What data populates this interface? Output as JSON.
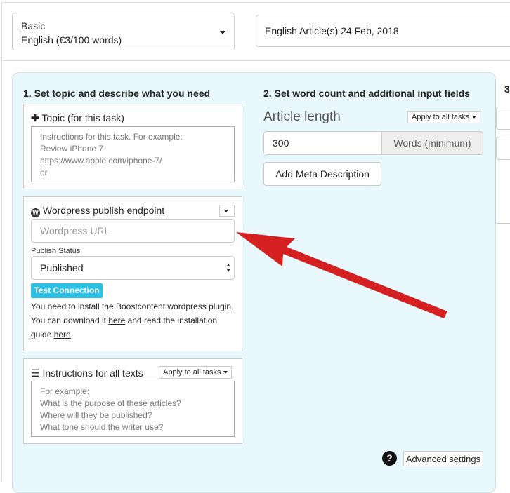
{
  "header": {
    "plan_line1": "Basic",
    "plan_line2": "English (€3/100 words)",
    "project_title": "English Article(s) 24 Feb, 2018"
  },
  "step1": {
    "heading": "1. Set topic and describe what you need",
    "topic": {
      "label": "Topic (for this task)",
      "placeholder": "Instructions for this task. For example:\nReview iPhone 7\nhttps://www.apple.com/iphone-7/\nor"
    },
    "wordpress": {
      "label": "Wordpress publish endpoint",
      "url_placeholder": "Wordpress URL",
      "status_label": "Publish Status",
      "status_value": "Published",
      "test_button": "Test Connection",
      "help_part1": "You need to install the Boostcontent wordpress plugin. You can download it ",
      "link1": "here",
      "help_part2": " and read the installation guide ",
      "link2": "here",
      "help_part3": "."
    },
    "instructions": {
      "label": "Instructions for all texts",
      "apply_label": "Apply to all tasks",
      "placeholder": "For example:\nWhat is the purpose of these articles?\nWhere will they be published?\nWhat tone should the writer use?"
    }
  },
  "step2": {
    "heading": "2. Set word count and additional input fields",
    "article_length_label": "Article length",
    "apply_label": "Apply to all tasks",
    "word_count": "300",
    "word_unit": "Words (minimum)",
    "meta_button": "Add Meta Description"
  },
  "step3": {
    "heading_partial": "3"
  },
  "footer": {
    "help_icon": "?",
    "advanced_button": "Advanced settings"
  },
  "colors": {
    "panel_bg": "#e9f8fd",
    "test_button": "#2bc0e4",
    "arrow": "#d42020"
  }
}
